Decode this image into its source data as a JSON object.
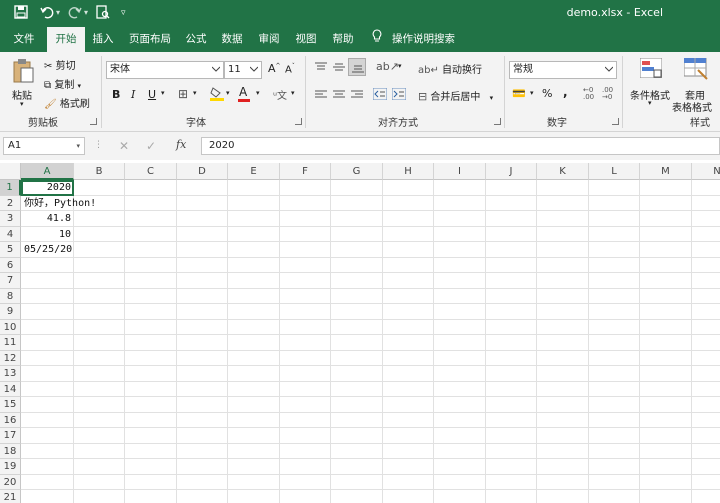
{
  "window": {
    "title": "demo.xlsx  -  Excel"
  },
  "tabs": [
    "文件",
    "开始",
    "插入",
    "页面布局",
    "公式",
    "数据",
    "审阅",
    "视图",
    "帮助"
  ],
  "tell_me": "操作说明搜索",
  "ribbon": {
    "clipboard": {
      "paste": "粘贴",
      "cut": "剪切",
      "copy": "复制",
      "format_painter": "格式刷",
      "label": "剪贴板"
    },
    "font": {
      "name": "宋体",
      "size": "11",
      "bold": "B",
      "italic": "I",
      "underline": "U",
      "font_color": "A",
      "label": "字体"
    },
    "alignment": {
      "wrap": "自动换行",
      "merge": "合并后居中",
      "label": "对齐方式"
    },
    "number": {
      "format": "常规",
      "percent": "%",
      "comma": ",",
      "label": "数字"
    },
    "styles": {
      "conditional": "条件格式",
      "table_1": "套用",
      "table_2": "表格格式",
      "label": "样式"
    }
  },
  "formula_bar": {
    "name_box": "A1",
    "fx": "fx",
    "value": "2020"
  },
  "sheet": {
    "columns": [
      "A",
      "B",
      "C",
      "D",
      "E",
      "F",
      "G",
      "H",
      "I",
      "J",
      "K",
      "L",
      "M",
      "N"
    ],
    "rows": [
      "1",
      "2",
      "3",
      "4",
      "5",
      "6",
      "7",
      "8",
      "9",
      "10",
      "11",
      "12",
      "13",
      "14",
      "15",
      "16",
      "17",
      "18",
      "19",
      "20",
      "21"
    ],
    "cells": {
      "A1": "2020",
      "A2": "你好，Python!",
      "A3": "41.8",
      "A4": "10",
      "A5": "05/25/20"
    },
    "selected": "A1"
  },
  "colors": {
    "brand": "#217346",
    "ribbon_bg": "#f3f3f3"
  }
}
